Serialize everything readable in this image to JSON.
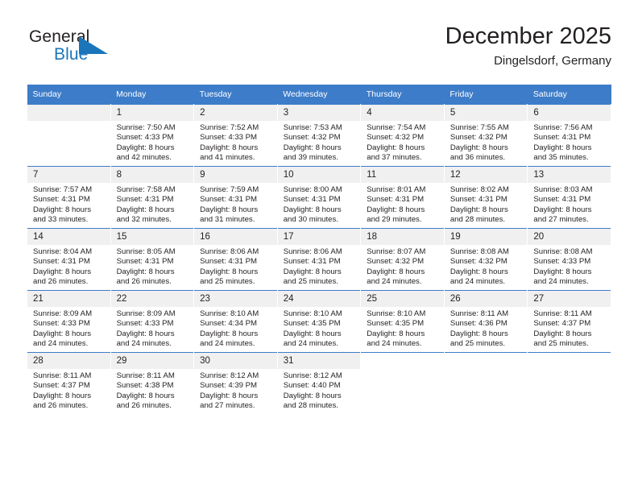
{
  "brand": {
    "name_part1": "General",
    "name_part2": "Blue",
    "triangle_color": "#1b75bb",
    "text_color": "#231f20"
  },
  "header": {
    "title": "December 2025",
    "location": "Dingelsdorf, Germany"
  },
  "theme": {
    "header_bg": "#3d7cc9",
    "header_text": "#ffffff",
    "daynum_bg": "#f0f0f0",
    "grid_line": "#3d7cc9",
    "body_text": "#231f20"
  },
  "calendar": {
    "weekday_headers": [
      "Sunday",
      "Monday",
      "Tuesday",
      "Wednesday",
      "Thursday",
      "Friday",
      "Saturday"
    ],
    "weeks": [
      [
        {
          "day": "",
          "sunrise": "",
          "sunset": "",
          "daylight_line1": "",
          "daylight_line2": "",
          "empty": true
        },
        {
          "day": "1",
          "sunrise": "Sunrise: 7:50 AM",
          "sunset": "Sunset: 4:33 PM",
          "daylight_line1": "Daylight: 8 hours",
          "daylight_line2": "and 42 minutes."
        },
        {
          "day": "2",
          "sunrise": "Sunrise: 7:52 AM",
          "sunset": "Sunset: 4:33 PM",
          "daylight_line1": "Daylight: 8 hours",
          "daylight_line2": "and 41 minutes."
        },
        {
          "day": "3",
          "sunrise": "Sunrise: 7:53 AM",
          "sunset": "Sunset: 4:32 PM",
          "daylight_line1": "Daylight: 8 hours",
          "daylight_line2": "and 39 minutes."
        },
        {
          "day": "4",
          "sunrise": "Sunrise: 7:54 AM",
          "sunset": "Sunset: 4:32 PM",
          "daylight_line1": "Daylight: 8 hours",
          "daylight_line2": "and 37 minutes."
        },
        {
          "day": "5",
          "sunrise": "Sunrise: 7:55 AM",
          "sunset": "Sunset: 4:32 PM",
          "daylight_line1": "Daylight: 8 hours",
          "daylight_line2": "and 36 minutes."
        },
        {
          "day": "6",
          "sunrise": "Sunrise: 7:56 AM",
          "sunset": "Sunset: 4:31 PM",
          "daylight_line1": "Daylight: 8 hours",
          "daylight_line2": "and 35 minutes."
        }
      ],
      [
        {
          "day": "7",
          "sunrise": "Sunrise: 7:57 AM",
          "sunset": "Sunset: 4:31 PM",
          "daylight_line1": "Daylight: 8 hours",
          "daylight_line2": "and 33 minutes."
        },
        {
          "day": "8",
          "sunrise": "Sunrise: 7:58 AM",
          "sunset": "Sunset: 4:31 PM",
          "daylight_line1": "Daylight: 8 hours",
          "daylight_line2": "and 32 minutes."
        },
        {
          "day": "9",
          "sunrise": "Sunrise: 7:59 AM",
          "sunset": "Sunset: 4:31 PM",
          "daylight_line1": "Daylight: 8 hours",
          "daylight_line2": "and 31 minutes."
        },
        {
          "day": "10",
          "sunrise": "Sunrise: 8:00 AM",
          "sunset": "Sunset: 4:31 PM",
          "daylight_line1": "Daylight: 8 hours",
          "daylight_line2": "and 30 minutes."
        },
        {
          "day": "11",
          "sunrise": "Sunrise: 8:01 AM",
          "sunset": "Sunset: 4:31 PM",
          "daylight_line1": "Daylight: 8 hours",
          "daylight_line2": "and 29 minutes."
        },
        {
          "day": "12",
          "sunrise": "Sunrise: 8:02 AM",
          "sunset": "Sunset: 4:31 PM",
          "daylight_line1": "Daylight: 8 hours",
          "daylight_line2": "and 28 minutes."
        },
        {
          "day": "13",
          "sunrise": "Sunrise: 8:03 AM",
          "sunset": "Sunset: 4:31 PM",
          "daylight_line1": "Daylight: 8 hours",
          "daylight_line2": "and 27 minutes."
        }
      ],
      [
        {
          "day": "14",
          "sunrise": "Sunrise: 8:04 AM",
          "sunset": "Sunset: 4:31 PM",
          "daylight_line1": "Daylight: 8 hours",
          "daylight_line2": "and 26 minutes."
        },
        {
          "day": "15",
          "sunrise": "Sunrise: 8:05 AM",
          "sunset": "Sunset: 4:31 PM",
          "daylight_line1": "Daylight: 8 hours",
          "daylight_line2": "and 26 minutes."
        },
        {
          "day": "16",
          "sunrise": "Sunrise: 8:06 AM",
          "sunset": "Sunset: 4:31 PM",
          "daylight_line1": "Daylight: 8 hours",
          "daylight_line2": "and 25 minutes."
        },
        {
          "day": "17",
          "sunrise": "Sunrise: 8:06 AM",
          "sunset": "Sunset: 4:31 PM",
          "daylight_line1": "Daylight: 8 hours",
          "daylight_line2": "and 25 minutes."
        },
        {
          "day": "18",
          "sunrise": "Sunrise: 8:07 AM",
          "sunset": "Sunset: 4:32 PM",
          "daylight_line1": "Daylight: 8 hours",
          "daylight_line2": "and 24 minutes."
        },
        {
          "day": "19",
          "sunrise": "Sunrise: 8:08 AM",
          "sunset": "Sunset: 4:32 PM",
          "daylight_line1": "Daylight: 8 hours",
          "daylight_line2": "and 24 minutes."
        },
        {
          "day": "20",
          "sunrise": "Sunrise: 8:08 AM",
          "sunset": "Sunset: 4:33 PM",
          "daylight_line1": "Daylight: 8 hours",
          "daylight_line2": "and 24 minutes."
        }
      ],
      [
        {
          "day": "21",
          "sunrise": "Sunrise: 8:09 AM",
          "sunset": "Sunset: 4:33 PM",
          "daylight_line1": "Daylight: 8 hours",
          "daylight_line2": "and 24 minutes."
        },
        {
          "day": "22",
          "sunrise": "Sunrise: 8:09 AM",
          "sunset": "Sunset: 4:33 PM",
          "daylight_line1": "Daylight: 8 hours",
          "daylight_line2": "and 24 minutes."
        },
        {
          "day": "23",
          "sunrise": "Sunrise: 8:10 AM",
          "sunset": "Sunset: 4:34 PM",
          "daylight_line1": "Daylight: 8 hours",
          "daylight_line2": "and 24 minutes."
        },
        {
          "day": "24",
          "sunrise": "Sunrise: 8:10 AM",
          "sunset": "Sunset: 4:35 PM",
          "daylight_line1": "Daylight: 8 hours",
          "daylight_line2": "and 24 minutes."
        },
        {
          "day": "25",
          "sunrise": "Sunrise: 8:10 AM",
          "sunset": "Sunset: 4:35 PM",
          "daylight_line1": "Daylight: 8 hours",
          "daylight_line2": "and 24 minutes."
        },
        {
          "day": "26",
          "sunrise": "Sunrise: 8:11 AM",
          "sunset": "Sunset: 4:36 PM",
          "daylight_line1": "Daylight: 8 hours",
          "daylight_line2": "and 25 minutes."
        },
        {
          "day": "27",
          "sunrise": "Sunrise: 8:11 AM",
          "sunset": "Sunset: 4:37 PM",
          "daylight_line1": "Daylight: 8 hours",
          "daylight_line2": "and 25 minutes."
        }
      ],
      [
        {
          "day": "28",
          "sunrise": "Sunrise: 8:11 AM",
          "sunset": "Sunset: 4:37 PM",
          "daylight_line1": "Daylight: 8 hours",
          "daylight_line2": "and 26 minutes."
        },
        {
          "day": "29",
          "sunrise": "Sunrise: 8:11 AM",
          "sunset": "Sunset: 4:38 PM",
          "daylight_line1": "Daylight: 8 hours",
          "daylight_line2": "and 26 minutes."
        },
        {
          "day": "30",
          "sunrise": "Sunrise: 8:12 AM",
          "sunset": "Sunset: 4:39 PM",
          "daylight_line1": "Daylight: 8 hours",
          "daylight_line2": "and 27 minutes."
        },
        {
          "day": "31",
          "sunrise": "Sunrise: 8:12 AM",
          "sunset": "Sunset: 4:40 PM",
          "daylight_line1": "Daylight: 8 hours",
          "daylight_line2": "and 28 minutes."
        },
        {
          "day": "",
          "sunrise": "",
          "sunset": "",
          "daylight_line1": "",
          "daylight_line2": "",
          "blank": true
        },
        {
          "day": "",
          "sunrise": "",
          "sunset": "",
          "daylight_line1": "",
          "daylight_line2": "",
          "blank": true
        },
        {
          "day": "",
          "sunrise": "",
          "sunset": "",
          "daylight_line1": "",
          "daylight_line2": "",
          "blank": true
        }
      ]
    ]
  }
}
